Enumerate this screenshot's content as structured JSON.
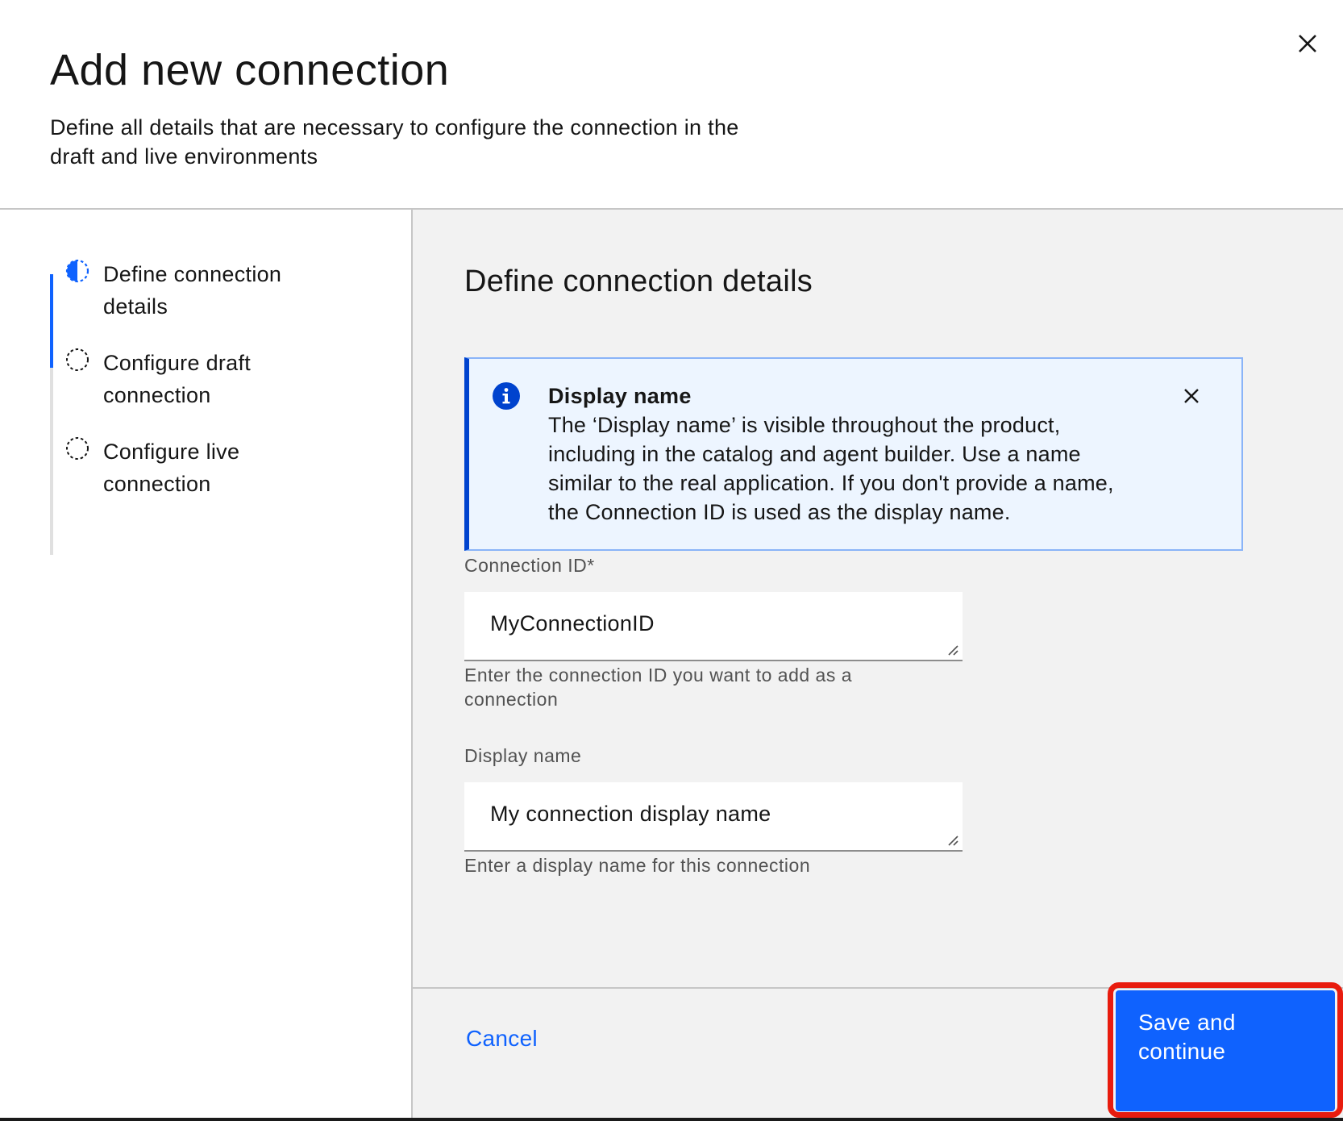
{
  "modal": {
    "title": "Add new connection",
    "description": "Define all details that are necessary to configure the connection in the draft and live environments",
    "close_icon": "close-icon"
  },
  "progress": {
    "steps": [
      {
        "label": "Define connection details",
        "state": "current",
        "icon": "half-filled-circle-icon"
      },
      {
        "label": "Configure draft connection",
        "state": "incomplete",
        "icon": "dashed-circle-icon"
      },
      {
        "label": "Configure live connection",
        "state": "incomplete",
        "icon": "dashed-circle-icon"
      }
    ]
  },
  "content": {
    "section_title": "Define connection details",
    "notice": {
      "icon": "information-icon",
      "title": "Display name",
      "body": "The ‘Display name’ is visible throughout the product, including in the catalog and agent builder. Use a name similar to the real application. If you don't provide a name, the Connection ID is used as the display name.",
      "close_icon": "close-icon"
    },
    "fields": [
      {
        "label": "Connection ID*",
        "value": "MyConnectionID",
        "helper": "Enter the connection ID you want to add as a connection"
      },
      {
        "label": "Display name",
        "value": "My connection display name",
        "helper": "Enter a display name for this connection"
      }
    ]
  },
  "footer": {
    "cancel_label": "Cancel",
    "save_label": "Save and continue"
  },
  "colors": {
    "primary": "#0f62fe",
    "notice_bg": "#edf5ff",
    "notice_border": "#0043ce",
    "highlight": "#e81c0e",
    "content_bg": "#f2f2f2"
  }
}
